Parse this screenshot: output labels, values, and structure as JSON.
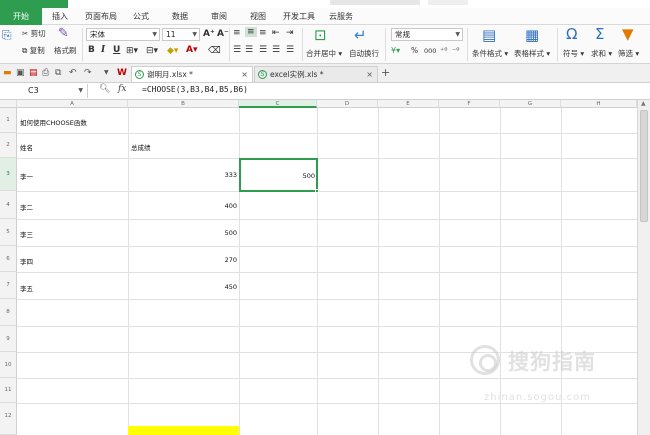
{
  "menu": {
    "tabs": [
      "开始",
      "插入",
      "页面布局",
      "公式",
      "数据",
      "审阅",
      "视图",
      "开发工具",
      "云服务"
    ],
    "active_index": 0
  },
  "ribbon": {
    "cut": "剪切",
    "copy": "复制",
    "format_painter": "格式刷",
    "font_name": "宋体",
    "font_size": "11",
    "grow_font": "A⁺",
    "shrink_font": "A⁻",
    "bold": "B",
    "italic": "I",
    "underline": "U",
    "merge_center": "合并居中",
    "wrap_text": "自动换行",
    "number_format": "常规",
    "percent": "%",
    "thousands": "000",
    "conditional_format": "条件格式",
    "table_style": "表格样式",
    "symbol": "符号",
    "sum": "求和",
    "filter": "筛选"
  },
  "doc_tabs": [
    {
      "label": "谢明月.xlsx *",
      "close": "×"
    },
    {
      "label": "excel实例.xls *",
      "close": "×"
    }
  ],
  "add_tab": "+",
  "formula_bar": {
    "name_box": "C3",
    "fx": "fx",
    "formula": "=CHOOSE(3,B3,B4,B5,B6)"
  },
  "columns": [
    "A",
    "B",
    "C",
    "D",
    "E",
    "F",
    "G",
    "H"
  ],
  "active_column": "C",
  "rows": [
    "1",
    "2",
    "3",
    "4",
    "5",
    "6",
    "7",
    "8",
    "9",
    "10",
    "11",
    "12"
  ],
  "active_row": "3",
  "cells": {
    "A1": "如何使用CHOOSE函数",
    "A2": "姓名",
    "B2": "总成绩",
    "A3": "李一",
    "B3": "333",
    "C3": "500",
    "A4": "李二",
    "B4": "400",
    "A5": "李三",
    "B5": "500",
    "A6": "李四",
    "B6": "270",
    "A7": "李五",
    "B7": "450"
  },
  "watermark": {
    "text": "搜狗指南",
    "url": "zhinan.sogou.com"
  },
  "colors": {
    "accent": "#2e9d4f",
    "highlight": "#ffff00"
  }
}
